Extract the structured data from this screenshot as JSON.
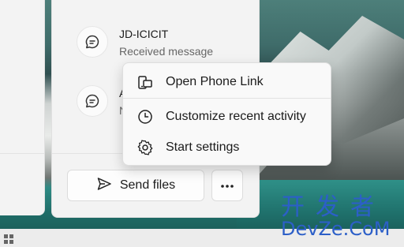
{
  "notifications": [
    {
      "title": "JD-ICICIT",
      "subtitle": "Received message"
    },
    {
      "title": "A",
      "subtitle": "N"
    }
  ],
  "actions": {
    "send_files_label": "Send files",
    "more_icon": "ellipsis-icon"
  },
  "context_menu": {
    "items": [
      {
        "label": "Open Phone Link",
        "icon": "phone-link-icon"
      },
      {
        "label": "Customize recent activity",
        "icon": "clock-icon"
      },
      {
        "label": "Start settings",
        "icon": "gear-icon"
      }
    ]
  },
  "watermark": {
    "chinese": "开发者",
    "latin": "DevZe.CoM"
  },
  "colors": {
    "accent_watermark": "#2c5fc8",
    "panel_bg": "#f3f3f3"
  }
}
